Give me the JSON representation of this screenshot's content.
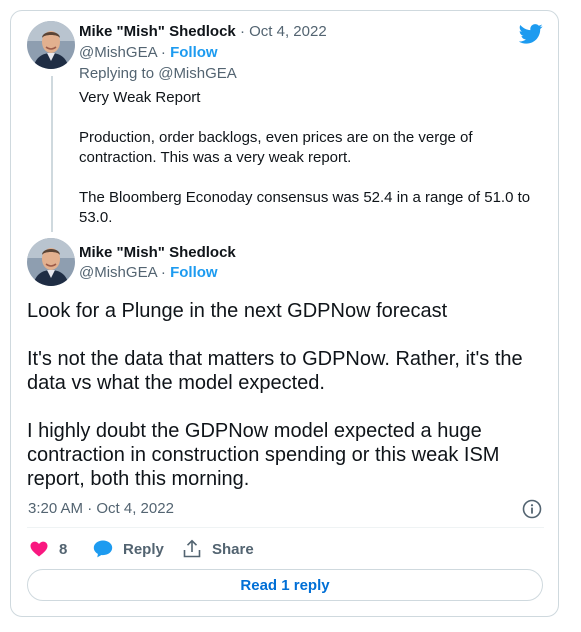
{
  "parent_tweet": {
    "author_name": "Mike \"Mish\" Shedlock",
    "separator": "·",
    "date": "Oct 4, 2022",
    "handle": "@MishGEA",
    "follow_label": "Follow",
    "replying_to": "Replying to @MishGEA",
    "lines": [
      "Very Weak Report",
      "",
      "Production, order backlogs, even prices are on the verge of",
      "contraction. This was a very weak report.",
      "",
      "The Bloomberg Econoday consensus was 52.4 in a range of 51.0 to",
      "53.0."
    ]
  },
  "main_tweet": {
    "author_name": "Mike \"Mish\" Shedlock",
    "handle": "@MishGEA",
    "separator": "·",
    "follow_label": "Follow",
    "lines": [
      "Look for a Plunge in the next GDPNow forecast",
      "",
      "It's not the data that matters to GDPNow. Rather, it's the",
      "data vs what the model expected.",
      "",
      "I highly doubt the GDPNow model expected a huge",
      "contraction in construction spending or this weak ISM",
      "report, both this morning."
    ],
    "timestamp": "3:20 AM · Oct 4, 2022",
    "likes": "8",
    "reply_label": "Reply",
    "share_label": "Share"
  },
  "read_reply_label": "Read 1 reply",
  "icons": {
    "brand": "twitter-bird-icon",
    "info": "info-icon",
    "like": "heart-icon",
    "reply": "speech-bubble-icon",
    "share": "share-icon"
  },
  "colors": {
    "brand_blue": "#1d9bf0",
    "like_red": "#f91880",
    "link_blue": "#006fd6",
    "secondary_text": "#536471"
  }
}
